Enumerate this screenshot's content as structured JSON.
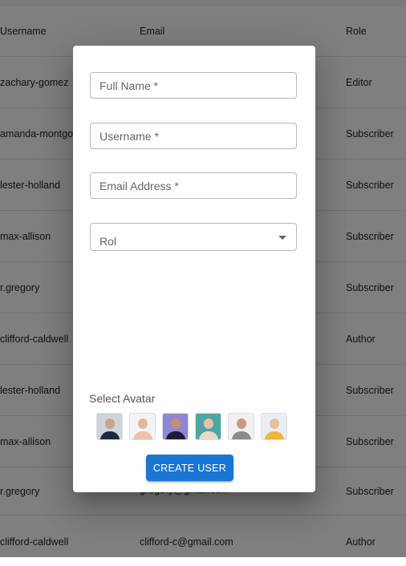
{
  "table": {
    "headers": {
      "username": "Username",
      "email": "Email",
      "role": "Role"
    },
    "rows": [
      {
        "username": "zachary-gomez",
        "email": "",
        "role": "Editor"
      },
      {
        "username": "amanda-montgo",
        "email": "",
        "role": "Subscriber"
      },
      {
        "username": "lester-holland",
        "email": "",
        "role": "Subscriber"
      },
      {
        "username": "max-allison",
        "email": "",
        "role": "Subscriber"
      },
      {
        "username": "r.gregory",
        "email": "",
        "role": "Subscriber"
      },
      {
        "username": "clifford-caldwell",
        "email": "",
        "role": "Author"
      },
      {
        "username": "lester-holland",
        "email": "",
        "role": "Subscriber"
      },
      {
        "username": "max-allison",
        "email": "",
        "role": "Subscriber"
      },
      {
        "username": "r.gregory",
        "email": "gregory@gmail.com",
        "role": "Subscriber"
      },
      {
        "username": "clifford-caldwell",
        "email": "clifford-c@gmail.com",
        "role": "Author"
      }
    ]
  },
  "dialog": {
    "fields": {
      "full_name": "Full Name *",
      "username": "Username *",
      "email": "Email Address *",
      "role": "Rol"
    },
    "avatar_label": "Select Avatar",
    "avatars": [
      {
        "icon": "avatar-photo-1",
        "bg": "#cfd3da",
        "skin": "#c9a58c",
        "shirt": "#1e2a44"
      },
      {
        "icon": "avatar-photo-2",
        "bg": "#f3f3f3",
        "skin": "#e2b79c",
        "shirt": "#f2c1a9"
      },
      {
        "icon": "avatar-photo-3",
        "bg": "#8f86d6",
        "skin": "#c58f74",
        "shirt": "#1c1c3a"
      },
      {
        "icon": "avatar-photo-4",
        "bg": "#4aa7a8",
        "skin": "#e8c2a2",
        "shirt": "#ead9c5"
      },
      {
        "icon": "avatar-photo-5",
        "bg": "#f0f0f0",
        "skin": "#c79a7f",
        "shirt": "#8c8c8c"
      },
      {
        "icon": "avatar-photo-6",
        "bg": "#e9eef3",
        "skin": "#e5bf9f",
        "shirt": "#f0b63c"
      }
    ],
    "create_button": "CREATE USER"
  },
  "colors": {
    "primary": "#1976d2",
    "overlay": "rgba(0,0,0,0.5)"
  }
}
